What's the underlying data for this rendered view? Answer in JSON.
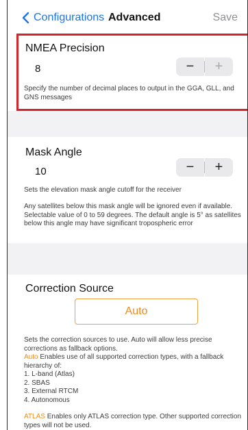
{
  "nav": {
    "back_label": "Configurations",
    "title": "Advanced",
    "save_label": "Save"
  },
  "nmea": {
    "title": "NMEA Precision",
    "value": "8",
    "minus": "−",
    "plus": "+",
    "description": "Specify the number of decimal places to output in the GGA, GLL, and GNS messages"
  },
  "mask": {
    "title": "Mask Angle",
    "value": "10",
    "minus": "−",
    "plus": "+",
    "description1": "Sets the elevation mask angle cutoff for the receiver",
    "description2": "Any satellites below this mask angle will be ignored even if available. Selectable value of 0 to 59 degrees. The default angle is 5° as satellites below this angle may have significant tropospheric error"
  },
  "correction": {
    "title": "Correction Source",
    "button_label": "Auto",
    "description": "Sets the correction sources to use. Auto will allow less precise corrections as fallback options.",
    "auto_keyword": "Auto",
    "auto_text": " Enables use of all supported correction types, with a fallback hierarchy of:",
    "items": [
      "1. L-band (Atlas)",
      "2. SBAS",
      "3. External RTCM",
      "4. Autonomous"
    ],
    "atlas_keyword": "ATLAS",
    "atlas_text": " Enables only ATLAS correction type. Other supported correction types will not be used."
  },
  "colors": {
    "accent_blue": "#1b74e8",
    "accent_orange": "#f08a1c",
    "highlight_red": "#d3242a"
  }
}
